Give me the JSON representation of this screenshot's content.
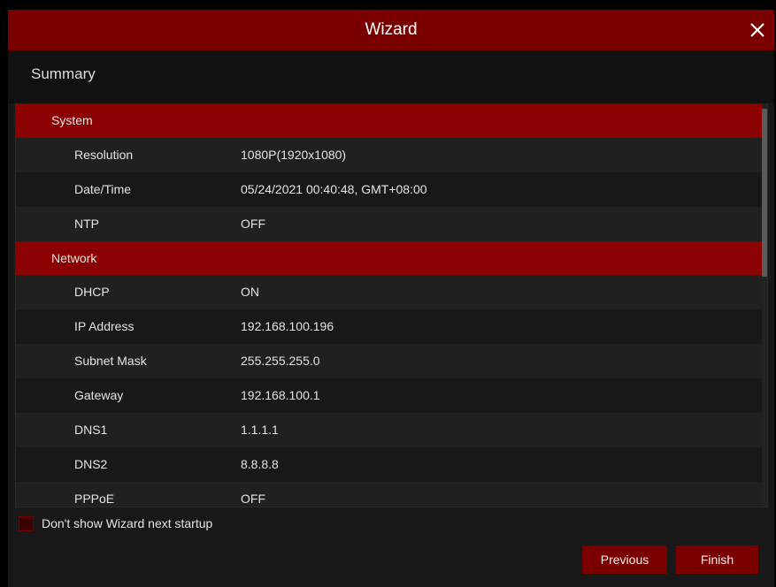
{
  "window": {
    "title": "Wizard"
  },
  "page": {
    "subtitle": "Summary"
  },
  "summary": {
    "sections": [
      {
        "label": "System",
        "rows": [
          {
            "label": "Resolution",
            "value": "1080P(1920x1080)"
          },
          {
            "label": "Date/Time",
            "value": "05/24/2021 00:40:48, GMT+08:00"
          },
          {
            "label": "NTP",
            "value": "OFF"
          }
        ]
      },
      {
        "label": "Network",
        "rows": [
          {
            "label": "DHCP",
            "value": "ON"
          },
          {
            "label": "IP Address",
            "value": "192.168.100.196"
          },
          {
            "label": "Subnet Mask",
            "value": "255.255.255.0"
          },
          {
            "label": "Gateway",
            "value": "192.168.100.1"
          },
          {
            "label": "DNS1",
            "value": "1.1.1.1"
          },
          {
            "label": "DNS2",
            "value": "8.8.8.8"
          },
          {
            "label": "PPPoE",
            "value": "OFF"
          }
        ]
      }
    ]
  },
  "options": {
    "dont_show_label": "Don't show Wizard next startup",
    "dont_show_checked": false
  },
  "buttons": {
    "previous": "Previous",
    "finish": "Finish"
  },
  "colors": {
    "accent": "#7a0000",
    "section": "#8b0000",
    "background": "#181818"
  },
  "icons": {
    "close": "close-icon"
  }
}
